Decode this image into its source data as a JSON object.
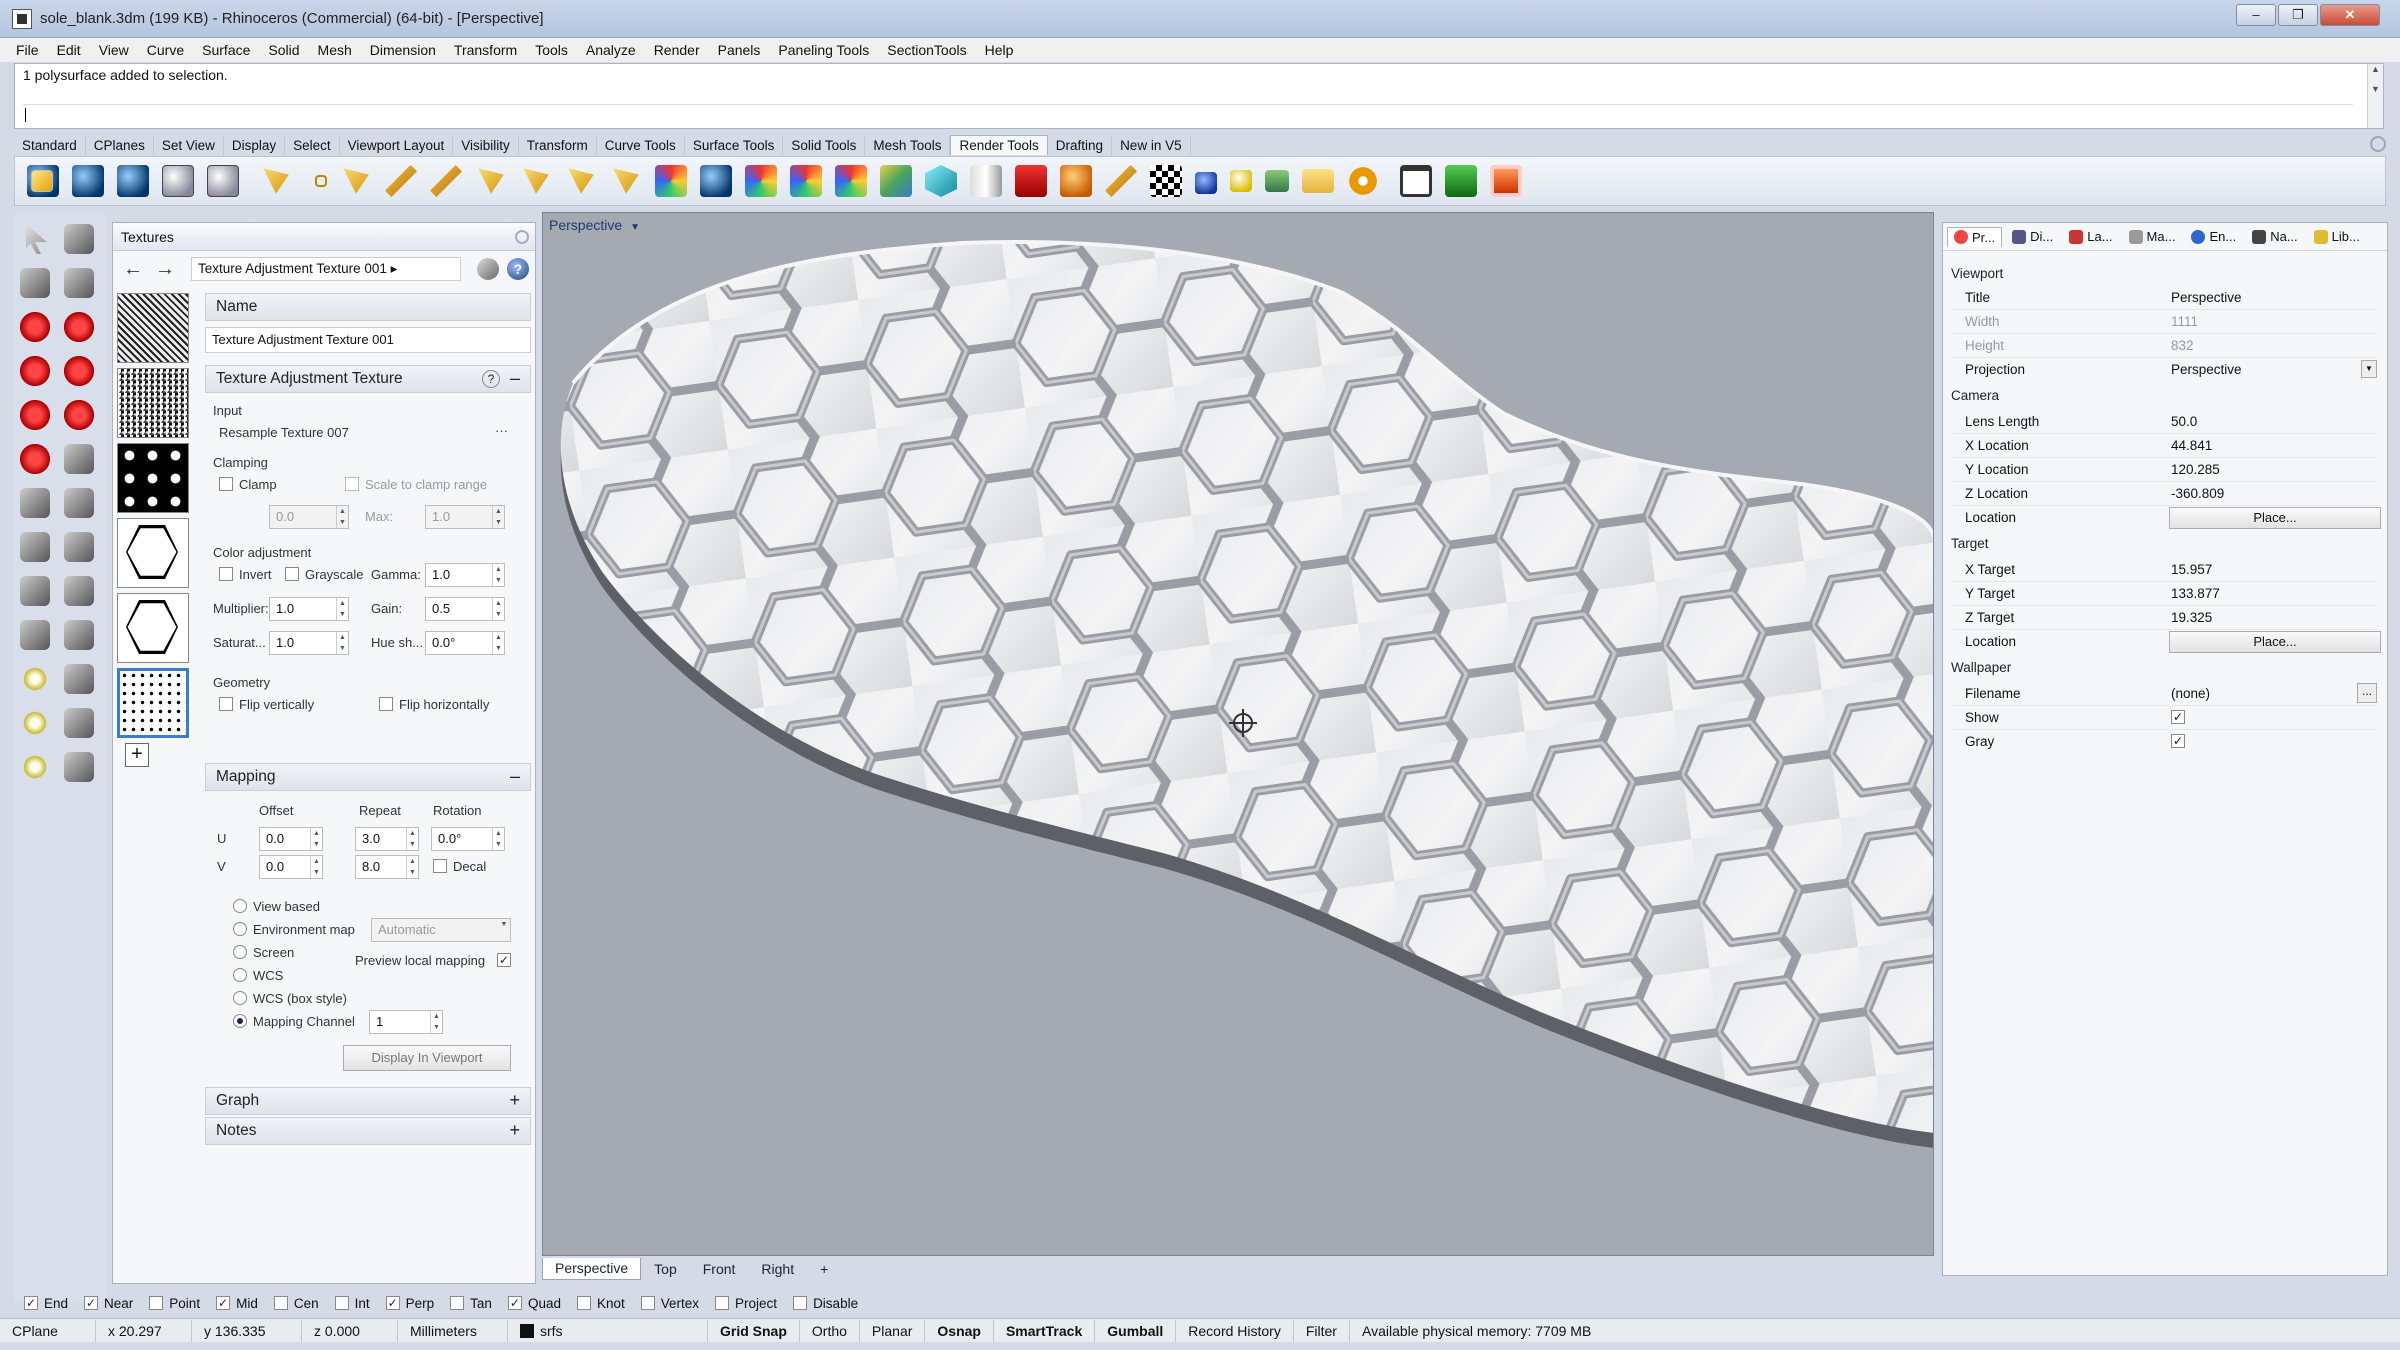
{
  "window": {
    "title": "sole_blank.3dm (199 KB) - Rhinoceros (Commercial) (64-bit) - [Perspective]",
    "buttons": [
      "–",
      "❐",
      "✕"
    ]
  },
  "menu": [
    "File",
    "Edit",
    "View",
    "Curve",
    "Surface",
    "Solid",
    "Mesh",
    "Dimension",
    "Transform",
    "Tools",
    "Analyze",
    "Render",
    "Panels",
    "Paneling Tools",
    "SectionTools",
    "Help"
  ],
  "command": {
    "history": "1 polysurface added to selection.",
    "prompt": ""
  },
  "toolbar_tabs": [
    "Standard",
    "CPlanes",
    "Set View",
    "Display",
    "Select",
    "Viewport Layout",
    "Visibility",
    "Transform",
    "Curve Tools",
    "Surface Tools",
    "Solid Tools",
    "Mesh Tools",
    "Render Tools",
    "Drafting",
    "New in V5"
  ],
  "toolbar_active_tab": "Render Tools",
  "textures_panel": {
    "title": "Textures",
    "breadcrumb": "Texture Adjustment Texture 001 ▸",
    "help": "?",
    "name_header": "Name",
    "name_value": "Texture Adjustment Texture 001",
    "section_title": "Texture Adjustment Texture",
    "section_help": "?",
    "input_label": "Input",
    "input_value": "Resample Texture 007",
    "input_more": "···",
    "clamping_label": "Clamping",
    "clamp_label": "Clamp",
    "scale_clamp_label": "Scale to clamp range",
    "min_value": "0.0",
    "max_label": "Max:",
    "max_value": "1.0",
    "color_adj_label": "Color adjustment",
    "invert_label": "Invert",
    "grayscale_label": "Grayscale",
    "gamma_label": "Gamma:",
    "gamma_value": "1.0",
    "multiplier_label": "Multiplier:",
    "multiplier_value": "1.0",
    "gain_label": "Gain:",
    "gain_value": "0.5",
    "saturation_label": "Saturat...",
    "saturation_value": "1.0",
    "hue_label": "Hue sh...",
    "hue_value": "0.0°",
    "geometry_label": "Geometry",
    "flip_v_label": "Flip vertically",
    "flip_h_label": "Flip horizontally",
    "mapping_title": "Mapping",
    "offset_label": "Offset",
    "repeat_label": "Repeat",
    "rotation_label": "Rotation",
    "u_label": "U",
    "v_label": "V",
    "u_offset": "0.0",
    "v_offset": "0.0",
    "u_repeat": "3.0",
    "v_repeat": "8.0",
    "rotation_value": "0.0°",
    "decal_label": "Decal",
    "view_based": "View based",
    "env_map": "Environment map",
    "env_map_value": "Automatic",
    "screen": "Screen",
    "preview_local": "Preview local mapping",
    "wcs": "WCS",
    "wcs_box": "WCS (box style)",
    "mapping_channel": "Mapping Channel",
    "mapping_channel_value": "1",
    "display_btn": "Display In Viewport",
    "graph_title": "Graph",
    "notes_title": "Notes",
    "collapse": "–",
    "expand": "+",
    "add": "+"
  },
  "viewport": {
    "title": "Perspective",
    "tabs": [
      "Perspective",
      "Top",
      "Front",
      "Right",
      "+"
    ]
  },
  "properties": {
    "tabs": [
      "Pr...",
      "Di...",
      "La...",
      "Ma...",
      "En...",
      "Na...",
      "Lib..."
    ],
    "viewport_section": "Viewport",
    "title_label": "Title",
    "title_value": "Perspective",
    "width_label": "Width",
    "width_value": "1111",
    "height_label": "Height",
    "height_value": "832",
    "projection_label": "Projection",
    "projection_value": "Perspective",
    "camera_section": "Camera",
    "lens_label": "Lens Length",
    "lens_value": "50.0",
    "xloc_label": "X Location",
    "xloc_value": "44.841",
    "yloc_label": "Y Location",
    "yloc_value": "120.285",
    "zloc_label": "Z Location",
    "zloc_value": "-360.809",
    "loc_label": "Location",
    "place_btn": "Place...",
    "target_section": "Target",
    "xt_label": "X Target",
    "xt_value": "15.957",
    "yt_label": "Y Target",
    "yt_value": "133.877",
    "zt_label": "Z Target",
    "zt_value": "19.325",
    "tloc_label": "Location",
    "tplace_btn": "Place...",
    "wallpaper_section": "Wallpaper",
    "file_label": "Filename",
    "file_value": "(none)",
    "show_label": "Show",
    "gray_label": "Gray",
    "check": "✓",
    "more": "..."
  },
  "osnaps": [
    {
      "label": "End",
      "on": true
    },
    {
      "label": "Near",
      "on": true
    },
    {
      "label": "Point",
      "on": false
    },
    {
      "label": "Mid",
      "on": true
    },
    {
      "label": "Cen",
      "on": false
    },
    {
      "label": "Int",
      "on": false
    },
    {
      "label": "Perp",
      "on": true
    },
    {
      "label": "Tan",
      "on": false
    },
    {
      "label": "Quad",
      "on": true
    },
    {
      "label": "Knot",
      "on": false
    },
    {
      "label": "Vertex",
      "on": false
    },
    {
      "label": "Project",
      "on": false
    },
    {
      "label": "Disable",
      "on": false
    }
  ],
  "status": {
    "cplane": "CPlane",
    "x": "x 20.297",
    "y": "y 136.335",
    "z": "z 0.000",
    "units": "Millimeters",
    "layer": "srfs",
    "grid_snap": "Grid Snap",
    "ortho": "Ortho",
    "planar": "Planar",
    "osnap": "Osnap",
    "smarttrack": "SmartTrack",
    "gumball": "Gumball",
    "record_history": "Record History",
    "filter": "Filter",
    "memory": "Available physical memory: 7709 MB"
  }
}
